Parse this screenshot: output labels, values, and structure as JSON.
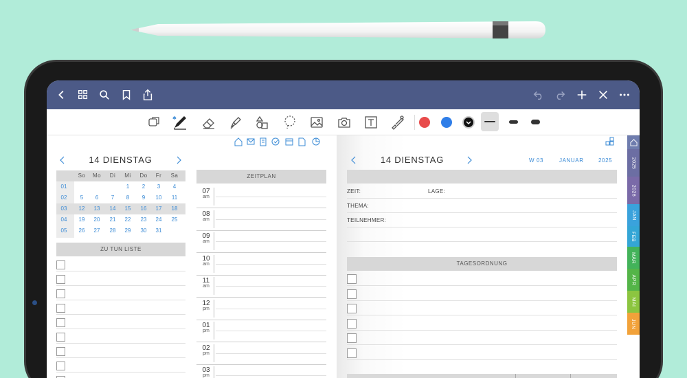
{
  "toolbar_colors": {
    "red": "#e84b4b",
    "blue": "#2f7ee8",
    "black": "#111111"
  },
  "left": {
    "date_title": "14 DIENSTAG",
    "weekdays": [
      "So",
      "Mo",
      "Di",
      "Mi",
      "Do",
      "Fr",
      "Sa"
    ],
    "weeks": [
      {
        "wk": "01",
        "days": [
          "",
          "",
          "",
          "1",
          "2",
          "3",
          "4"
        ]
      },
      {
        "wk": "02",
        "days": [
          "5",
          "6",
          "7",
          "8",
          "9",
          "10",
          "11"
        ]
      },
      {
        "wk": "03",
        "days": [
          "12",
          "13",
          "14",
          "15",
          "16",
          "17",
          "18"
        ]
      },
      {
        "wk": "04",
        "days": [
          "19",
          "20",
          "21",
          "22",
          "23",
          "24",
          "25"
        ]
      },
      {
        "wk": "05",
        "days": [
          "26",
          "27",
          "28",
          "29",
          "30",
          "31",
          ""
        ]
      }
    ],
    "highlight_week": "03",
    "todo_header": "ZU TUN LISTE",
    "schedule_header": "ZEITPLAN",
    "hours": [
      {
        "h": "07",
        "ap": "am"
      },
      {
        "h": "08",
        "ap": "am"
      },
      {
        "h": "09",
        "ap": "am"
      },
      {
        "h": "10",
        "ap": "am"
      },
      {
        "h": "11",
        "ap": "am"
      },
      {
        "h": "12",
        "ap": "pm"
      },
      {
        "h": "01",
        "ap": "pm"
      },
      {
        "h": "02",
        "ap": "pm"
      },
      {
        "h": "03",
        "ap": "pm"
      }
    ]
  },
  "right": {
    "date_title": "14 DIENSTAG",
    "week": "W 03",
    "month": "JANUAR",
    "year": "2025",
    "zeit": "ZEIT:",
    "lage": "LAGE:",
    "thema": "THEMA:",
    "teilnehmer": "TEILNEHMER:",
    "agenda_header": "TAGESORDNUNG"
  },
  "side_tabs": [
    {
      "label": "2025",
      "color": "#6c6ea3"
    },
    {
      "label": "2026",
      "color": "#7a6aa8"
    },
    {
      "label": "JAN",
      "color": "#3aa2dc"
    },
    {
      "label": "FEB",
      "color": "#34a6d6"
    },
    {
      "label": "MÄR",
      "color": "#43b35a"
    },
    {
      "label": "APR",
      "color": "#54b548"
    },
    {
      "label": "MAI",
      "color": "#8cc540"
    },
    {
      "label": "JUN",
      "color": "#f2a23a"
    }
  ]
}
